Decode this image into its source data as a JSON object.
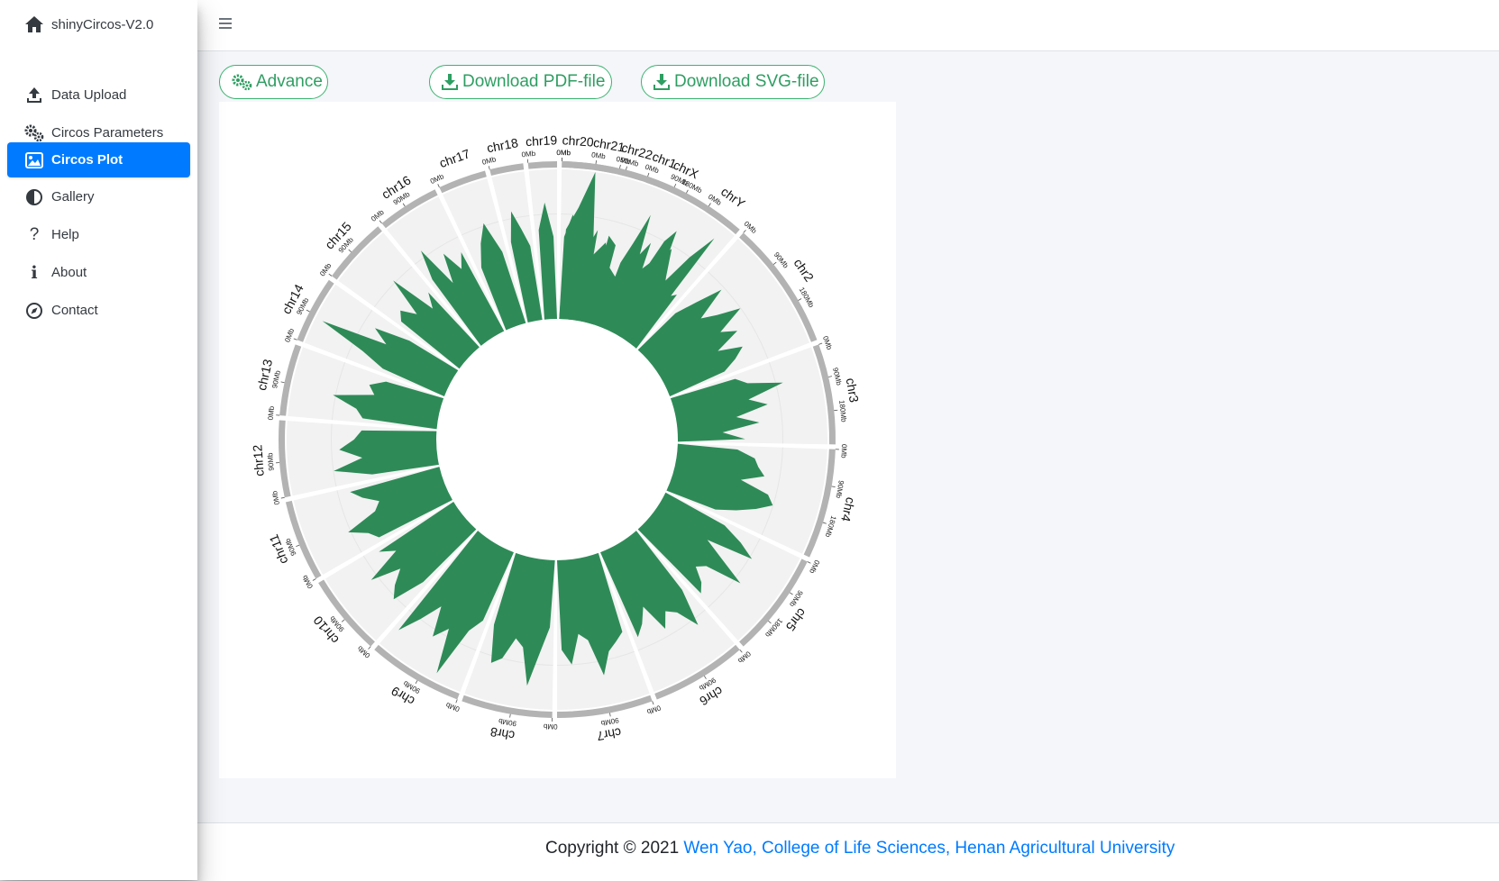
{
  "brand": {
    "title": "shinyCircos-V2.0",
    "icon": "home-icon"
  },
  "sidebar": {
    "items": [
      {
        "label": "Data Upload",
        "icon": "upload-icon",
        "active": false
      },
      {
        "label": "Circos Parameters",
        "icon": "cogs-icon",
        "active": false
      },
      {
        "label": "Circos Plot",
        "icon": "image-icon",
        "active": true
      },
      {
        "label": "Gallery",
        "icon": "adjust-icon",
        "active": false
      },
      {
        "label": "Help",
        "icon": "question-icon",
        "active": false
      },
      {
        "label": "About",
        "icon": "info-icon",
        "active": false
      },
      {
        "label": "Contact",
        "icon": "compass-icon",
        "active": false
      }
    ]
  },
  "toolbar": {
    "advance_label": "Advance",
    "download_pdf_label": "Download PDF-file",
    "download_svg_label": "Download SVG-file"
  },
  "footer": {
    "prefix": "Copyright © 2021 ",
    "link_text": "Wen Yao, College of Life Sciences, Henan Agricultural University"
  },
  "colors": {
    "accent": "#007bff",
    "button_green": "#2e9e62",
    "track_fill": "#2e8b57",
    "track_background": "#f2f2f2",
    "ideogram": "#b3b3b3"
  },
  "chart_data": {
    "type": "circos",
    "chromosomes": [
      {
        "name": "chr1",
        "ticks": [
          "0Mb",
          "90Mb",
          "180Mb"
        ]
      },
      {
        "name": "chr2",
        "ticks": [
          "0Mb",
          "90Mb",
          "180Mb"
        ]
      },
      {
        "name": "chr3",
        "ticks": [
          "0Mb",
          "90Mb",
          "180Mb"
        ]
      },
      {
        "name": "chr4",
        "ticks": [
          "0Mb",
          "90Mb",
          "180Mb"
        ]
      },
      {
        "name": "chr5",
        "ticks": [
          "0Mb",
          "90Mb",
          "180Mb"
        ]
      },
      {
        "name": "chr6",
        "ticks": [
          "0Mb",
          "90Mb"
        ]
      },
      {
        "name": "chr7",
        "ticks": [
          "0Mb",
          "90Mb"
        ]
      },
      {
        "name": "chr8",
        "ticks": [
          "0Mb",
          "90Mb"
        ]
      },
      {
        "name": "chr9",
        "ticks": [
          "0Mb",
          "90Mb"
        ]
      },
      {
        "name": "chr10",
        "ticks": [
          "0Mb",
          "90Mb"
        ]
      },
      {
        "name": "chr11",
        "ticks": [
          "0Mb",
          "90Mb"
        ]
      },
      {
        "name": "chr12",
        "ticks": [
          "0Mb",
          "90Mb"
        ]
      },
      {
        "name": "chr13",
        "ticks": [
          "0Mb",
          "90Mb"
        ]
      },
      {
        "name": "chr14",
        "ticks": [
          "0Mb",
          "90Mb"
        ]
      },
      {
        "name": "chr15",
        "ticks": [
          "0Mb",
          "90Mb"
        ]
      },
      {
        "name": "chr16",
        "ticks": [
          "0Mb",
          "90Mb"
        ]
      },
      {
        "name": "chr17",
        "ticks": [
          "0Mb"
        ]
      },
      {
        "name": "chr18",
        "ticks": [
          "0Mb"
        ]
      },
      {
        "name": "chr19",
        "ticks": [
          "0Mb"
        ]
      },
      {
        "name": "chr20",
        "ticks": [
          "0Mb"
        ]
      },
      {
        "name": "chr21",
        "ticks": [
          "0Mb"
        ]
      },
      {
        "name": "chr22",
        "ticks": [
          "0Mb"
        ]
      },
      {
        "name": "chrX",
        "ticks": [
          "0Mb",
          "90Mb"
        ]
      },
      {
        "name": "chrY",
        "ticks": [
          "0Mb"
        ]
      }
    ],
    "tracks": [
      {
        "type": "area",
        "values": [
          [
            0.6,
            0.75,
            1.0,
            0.45,
            0.55,
            0.4,
            0.35,
            0.5,
            0.42,
            0.55,
            0.68,
            0.5,
            0.38,
            0.45
          ],
          [
            0.35,
            0.5,
            0.68,
            0.45,
            0.55,
            0.7,
            0.5,
            0.6,
            0.42,
            0.58,
            0.5,
            0.4
          ],
          [
            0.45,
            0.52,
            0.75,
            0.5,
            0.62,
            0.4,
            0.55,
            0.3,
            0.45
          ],
          [
            0.4,
            0.52,
            0.55,
            0.6,
            0.45,
            0.65,
            0.7,
            0.6,
            0.48,
            0.35
          ],
          [
            0.45,
            0.6,
            0.72,
            0.4,
            0.55,
            0.75,
            0.5,
            0.45,
            0.55,
            0.6
          ],
          [
            0.5,
            0.75,
            0.6,
            0.55,
            0.65,
            0.45,
            0.55,
            0.62
          ],
          [
            0.55,
            0.6,
            0.65,
            0.8,
            0.55,
            0.5,
            0.7,
            0.6
          ],
          [
            0.45,
            0.62,
            0.85,
            0.6,
            0.55,
            0.7,
            0.75,
            0.5
          ],
          [
            0.5,
            0.6,
            0.95,
            0.65,
            0.75,
            0.55,
            0.7,
            0.85
          ],
          [
            0.5,
            0.72,
            0.65,
            0.55,
            0.75,
            0.5,
            0.6
          ],
          [
            0.55,
            0.6,
            0.72,
            0.5,
            0.45,
            0.55,
            0.62
          ],
          [
            0.45,
            0.7,
            0.5,
            0.65,
            0.55,
            0.5
          ],
          [
            0.5,
            0.55,
            0.72,
            0.45,
            0.5,
            0.4
          ],
          [
            0.45,
            0.62,
            0.95,
            0.5,
            0.62,
            0.38
          ],
          [
            0.5,
            0.55,
            0.45,
            0.72,
            0.4,
            0.5
          ],
          [
            0.55,
            0.75,
            0.45,
            0.65,
            0.5,
            0.6
          ],
          [
            0.45,
            0.6,
            0.72,
            0.5
          ],
          [
            0.55,
            0.75,
            0.62,
            0.5
          ],
          [
            0.6,
            0.78,
            0.55
          ],
          [
            0.55,
            0.7,
            0.6
          ],
          [
            0.5,
            0.62
          ],
          [
            0.6,
            0.55
          ],
          [
            0.45,
            0.6,
            0.82,
            0.55,
            0.65,
            0.4,
            0.7,
            0.8,
            0.6
          ],
          [
            0.45,
            0.7,
            0.9
          ]
        ]
      }
    ]
  }
}
